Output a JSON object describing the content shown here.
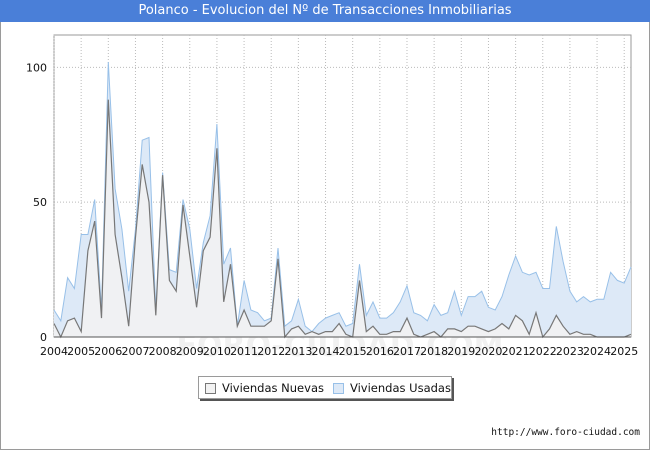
{
  "window": {
    "title": "Polanco - Evolucion del Nº de Transacciones Inmobiliarias"
  },
  "footer": {
    "url": "http://www.foro-ciudad.com"
  },
  "watermark": "FORO-CIUDAD.COM",
  "chart_data": {
    "type": "area",
    "title": "Polanco - Evolucion del Nº de Transacciones Inmobiliarias",
    "xlabel": "",
    "ylabel": "",
    "x_ticks": [
      "2004",
      "2005",
      "2006",
      "2007",
      "2008",
      "2009",
      "2010",
      "2011",
      "2012",
      "2013",
      "2014",
      "2015",
      "2016",
      "2017",
      "2018",
      "2019",
      "2020",
      "2021",
      "2022",
      "2023",
      "2024",
      "2025"
    ],
    "y_ticks": [
      0,
      50,
      100
    ],
    "ylim": [
      0,
      112
    ],
    "xlim": [
      2004,
      2025.25
    ],
    "grid": true,
    "legend_position": "bottom",
    "series": [
      {
        "name": "Viviendas Nuevas",
        "color": "#777777",
        "fill": "#f2f2f2",
        "values": [
          5,
          0,
          6,
          7,
          2,
          32,
          43,
          7,
          88,
          38,
          22,
          4,
          37,
          64,
          50,
          8,
          60,
          21,
          17,
          49,
          30,
          11,
          32,
          37,
          70,
          13,
          27,
          4,
          10,
          4,
          4,
          4,
          6,
          29,
          0,
          3,
          4,
          1,
          2,
          1,
          2,
          2,
          5,
          1,
          0,
          21,
          2,
          4,
          1,
          1,
          2,
          2,
          7,
          1,
          0,
          1,
          2,
          0,
          3,
          3,
          2,
          4,
          4,
          3,
          2,
          3,
          5,
          3,
          8,
          6,
          1,
          9,
          0,
          3,
          8,
          4,
          1,
          2,
          1,
          1,
          0,
          0,
          0,
          0,
          0,
          1
        ]
      },
      {
        "name": "Viviendas Usadas",
        "color": "#98c0e8",
        "fill": "#dde9f7",
        "values": [
          10,
          6,
          22,
          18,
          38,
          38,
          51,
          10,
          102,
          55,
          40,
          17,
          40,
          73,
          74,
          10,
          61,
          25,
          24,
          51,
          40,
          18,
          35,
          45,
          79,
          27,
          33,
          4,
          21,
          10,
          9,
          6,
          7,
          33,
          4,
          6,
          14,
          4,
          2,
          5,
          7,
          8,
          9,
          4,
          5,
          27,
          8,
          13,
          7,
          7,
          9,
          13,
          19,
          9,
          8,
          6,
          12,
          8,
          9,
          17,
          8,
          15,
          15,
          17,
          11,
          10,
          15,
          23,
          30,
          24,
          23,
          24,
          18,
          18,
          41,
          28,
          17,
          13,
          15,
          13,
          14,
          14,
          24,
          21,
          20,
          26
        ]
      }
    ]
  }
}
